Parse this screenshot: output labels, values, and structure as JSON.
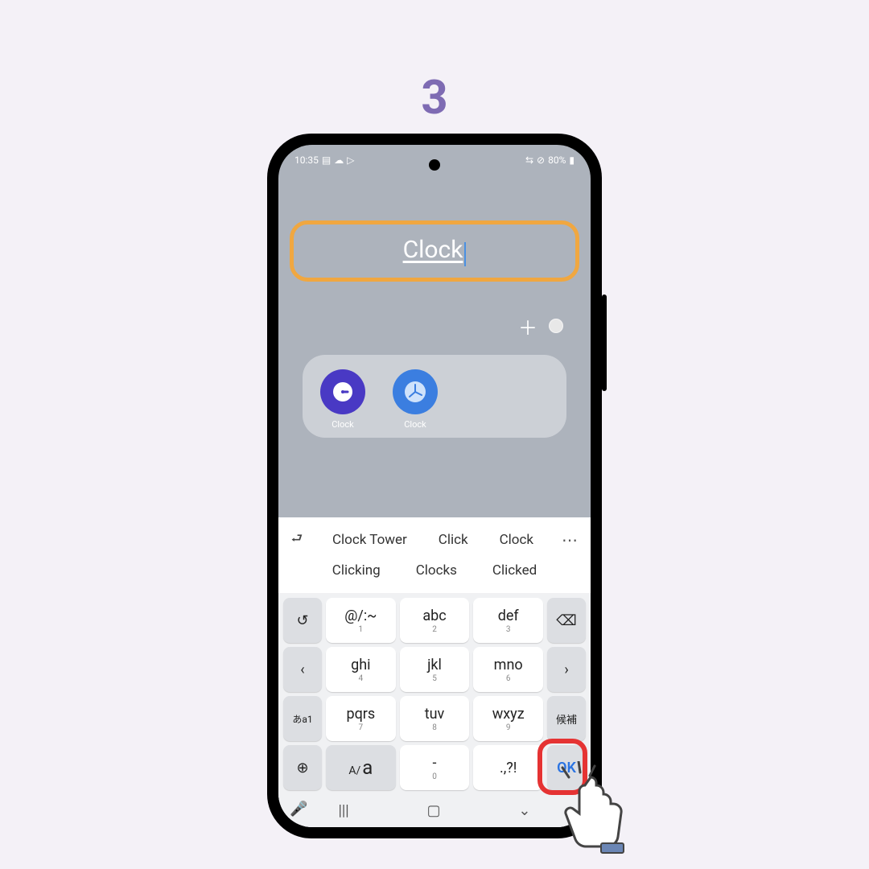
{
  "step": "3",
  "status": {
    "time": "10:35",
    "battery": "80%"
  },
  "folder": {
    "input_value": "Clock",
    "apps": [
      {
        "label": "Clock"
      },
      {
        "label": "Clock"
      }
    ]
  },
  "suggestions": {
    "row1": [
      "Clock Tower",
      "Click",
      "Clock"
    ],
    "row2": [
      "Clicking",
      "Clocks",
      "Clicked"
    ]
  },
  "keys": {
    "r1": [
      {
        "main": "@/:~",
        "sub": "1"
      },
      {
        "main": "abc",
        "sub": "2"
      },
      {
        "main": "def",
        "sub": "3"
      }
    ],
    "r2": [
      {
        "main": "ghi",
        "sub": "4"
      },
      {
        "main": "jkl",
        "sub": "5"
      },
      {
        "main": "mno",
        "sub": "6"
      }
    ],
    "r3": [
      {
        "main": "pqrs",
        "sub": "7"
      },
      {
        "main": "tuv",
        "sub": "8"
      },
      {
        "main": "wxyz",
        "sub": "9"
      }
    ],
    "r4": [
      {
        "main": "-",
        "sub": "0"
      },
      {
        "main": ".,?!",
        "sub": ""
      }
    ],
    "side": {
      "undo": "↺",
      "backspace": "⌫",
      "left": "‹",
      "right": "›",
      "mode": "あa1",
      "candidate": "候補",
      "globe": "⊕",
      "case_small": "A/",
      "case_big": "a",
      "ok": "OK"
    }
  },
  "nav": {
    "recent": "|||",
    "home": "▢",
    "back": "⌄"
  }
}
